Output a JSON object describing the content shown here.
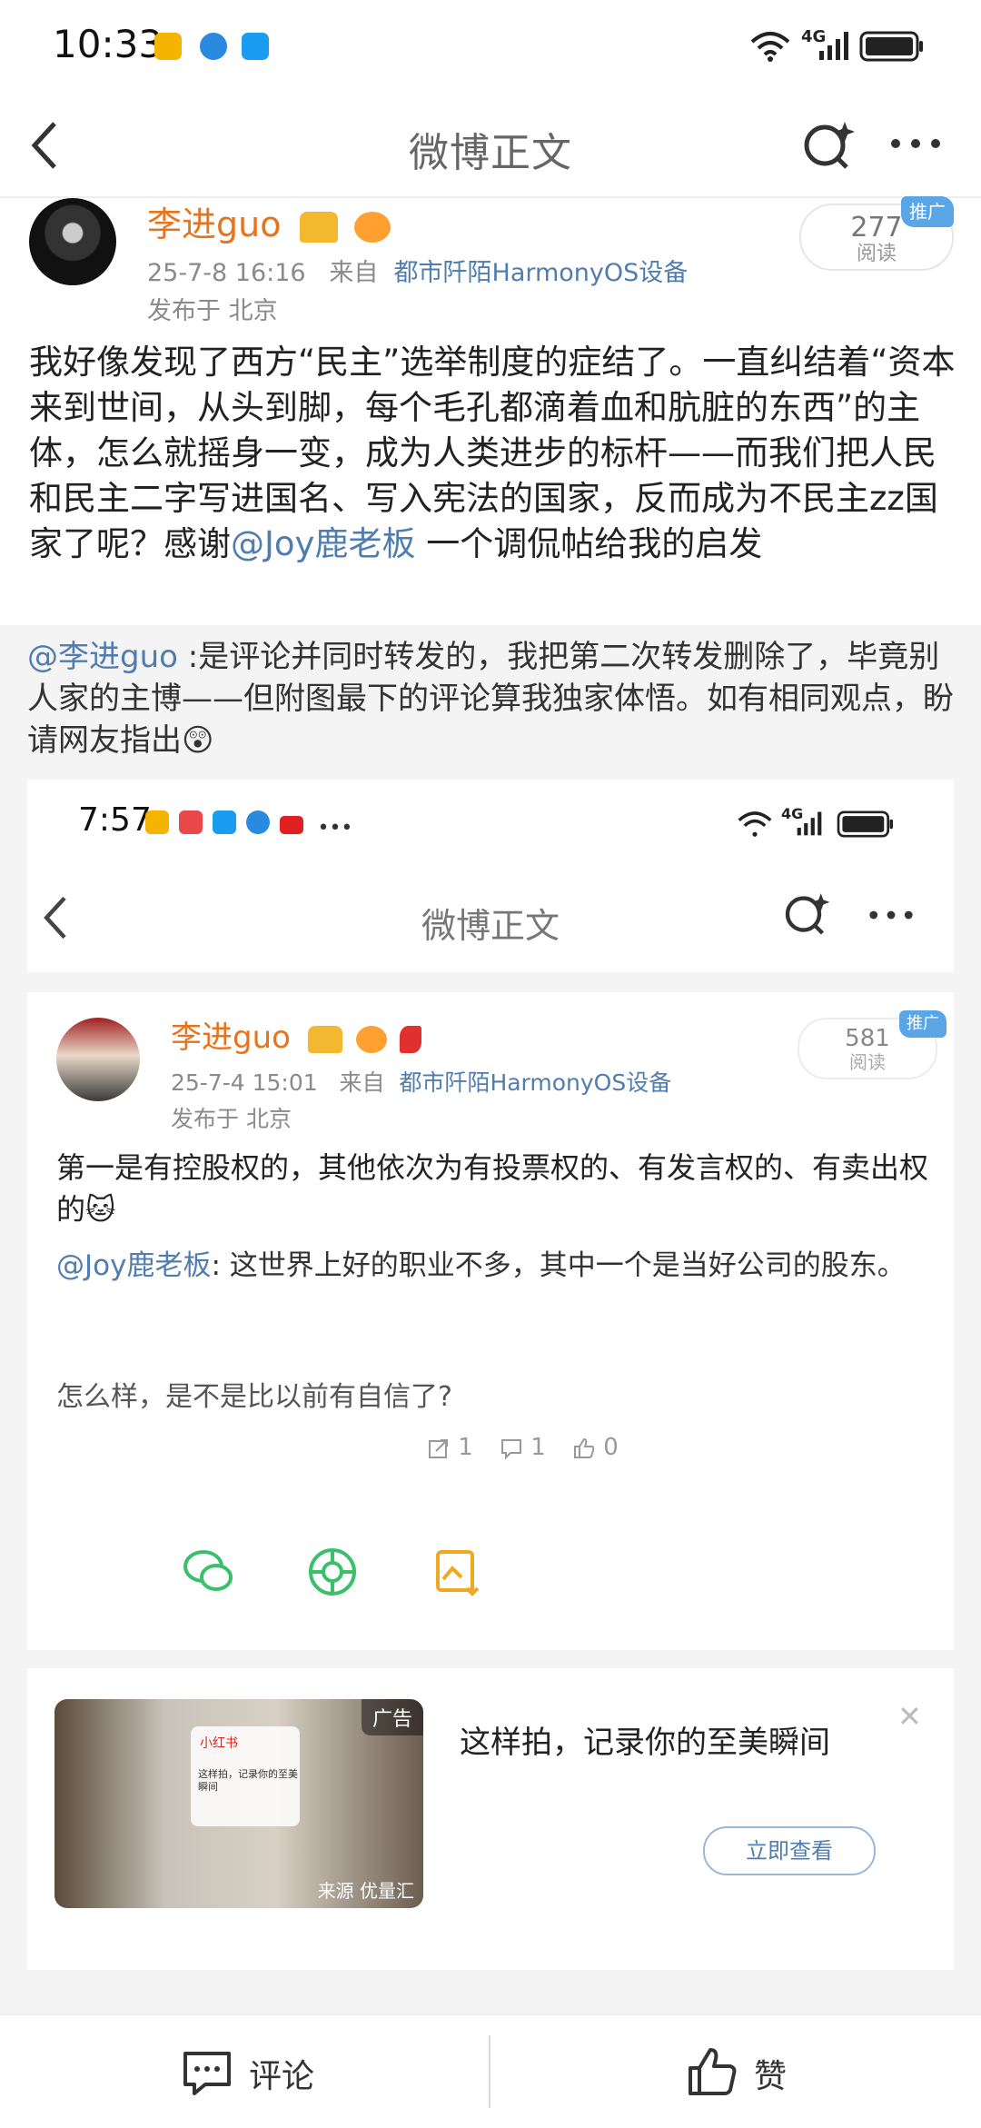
{
  "status_bar": {
    "time": "10:33",
    "network": "4G"
  },
  "nav": {
    "title": "微博正文"
  },
  "author": {
    "name": "李进guo",
    "date": "25-7-8 16:16",
    "from_label": "来自",
    "source": "都市阡陌HarmonyOS设备",
    "location": "发布于 北京"
  },
  "reads": {
    "count": "277",
    "label": "阅读",
    "promo": "推广"
  },
  "post": {
    "text_before": "我好像发现了西方“民主”选举制度的症结了。一直纠结着“资本来到世间，从头到脚，每个毛孔都滴着血和肮脏的东西”的主体，怎么就摇身一变，成为人类进步的标杆——而我们把人民和民主二字写进国名、写入宪法的国家，反而成为不民主zz国家了呢？感谢",
    "mention": "@Joy鹿老板",
    "text_after": " 一个调侃帖给我的启发"
  },
  "repost": {
    "mention": "@李进guo",
    "text": " :是评论并同时转发的，我把第二次转发删除了，毕竟别人家的主博——但附图最下的评论算我独家体悟。如有相同观点，盼请网友指出",
    "emoji": "😲"
  },
  "embedded": {
    "status_time": "7:57",
    "status_network": "4G",
    "nav_title": "微博正文",
    "author_name": "李进guo",
    "date": "25-7-4 15:01",
    "from_label": "来自",
    "source": "都市阡陌HarmonyOS设备",
    "location": "发布于 北京",
    "reads": "581",
    "reads_label": "阅读",
    "promo": "推广",
    "text": "第一是有控股权的，其他依次为有投票权的、有发言权的、有卖出权的",
    "text_emoji": "🐱",
    "quote_mention": "@Joy鹿老板",
    "quote_text": ": 这世界上好的职业不多，其中一个是当好公司的股东。",
    "question": "怎么样，是不是比以前有自信了?",
    "actions": {
      "repost": "1",
      "comment": "1",
      "like": "0"
    },
    "ad": {
      "tag": "广告",
      "source": "来源 优量汇",
      "title": "这样拍，记录你的至美瞬间",
      "button": "立即查看",
      "img_brand": "小红书",
      "img_caption": "这样拍，记录你的至美瞬间"
    }
  },
  "bottom_bar": {
    "comment_label": "评论",
    "like_label": "赞"
  },
  "colors": {
    "accent_orange": "#e8731d",
    "link_blue": "#507daf",
    "promo_blue": "#5aa5e6"
  }
}
